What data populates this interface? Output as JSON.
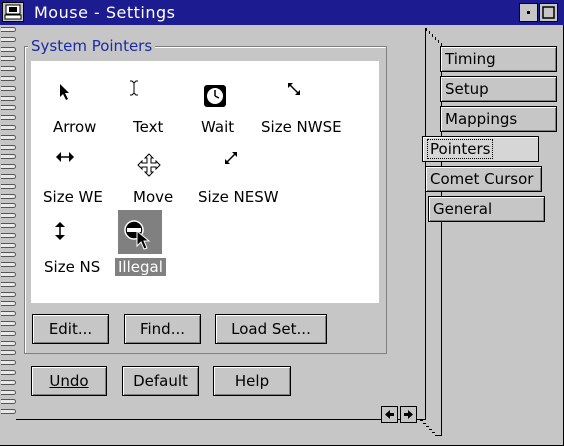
{
  "window": {
    "title": "Mouse - Settings"
  },
  "group": {
    "label": "System Pointers"
  },
  "pointers": [
    {
      "label": "Arrow",
      "icon": "arrow-pointer-icon"
    },
    {
      "label": "Text",
      "icon": "text-ibeam-icon"
    },
    {
      "label": "Wait",
      "icon": "clock-icon"
    },
    {
      "label": "Size NWSE",
      "icon": "size-nwse-icon"
    },
    {
      "label": "Size WE",
      "icon": "size-we-icon"
    },
    {
      "label": "Move",
      "icon": "move-icon"
    },
    {
      "label": "Size NESW",
      "icon": "size-nesw-icon"
    },
    {
      "label": "Size NS",
      "icon": "size-ns-icon"
    },
    {
      "label": "Illegal",
      "icon": "illegal-icon"
    }
  ],
  "group_buttons": {
    "edit": "Edit...",
    "find": "Find...",
    "load_set": "Load Set..."
  },
  "bottom_buttons": {
    "undo": "Undo",
    "default": "Default",
    "help": "Help"
  },
  "tabs": [
    {
      "label": "Timing",
      "underline": "T"
    },
    {
      "label": "Setup",
      "underline": "S"
    },
    {
      "label": "Mappings",
      "underline": "M"
    },
    {
      "label": "Pointers",
      "underline": "P"
    },
    {
      "label": "Comet Cursor",
      "underline": "C"
    },
    {
      "label": "General",
      "underline": "G"
    }
  ],
  "selected_tab": "Pointers",
  "selected_pointer": "Illegal"
}
